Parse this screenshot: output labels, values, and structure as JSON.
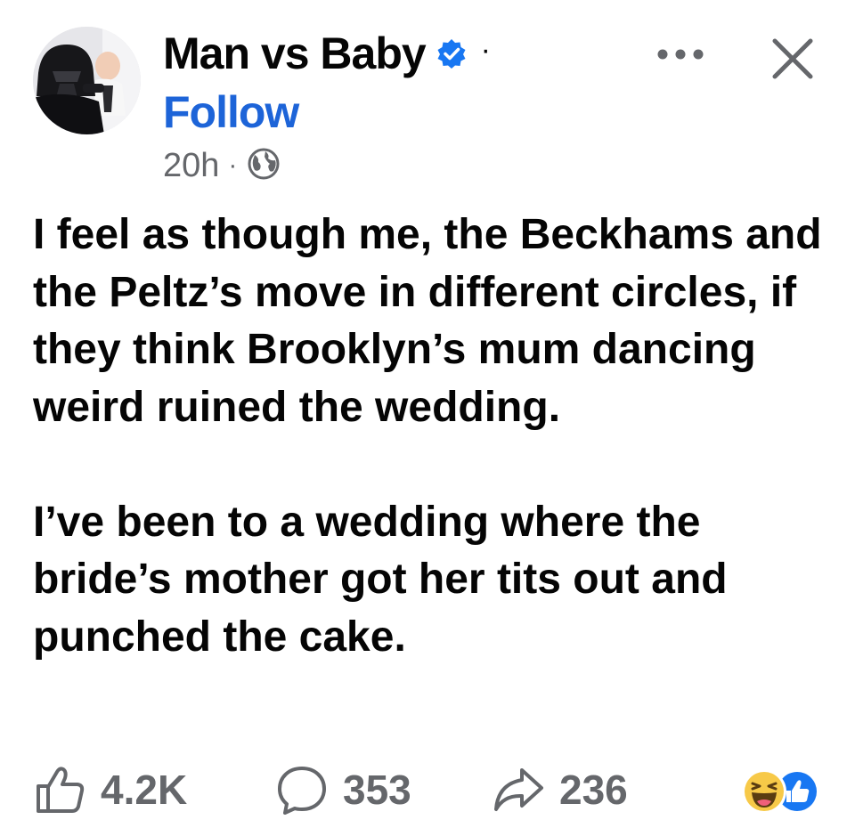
{
  "header": {
    "avatar_icon": "profile-photo-darth-vader-holding-baby",
    "page_name": "Man vs Baby",
    "verified_icon": "verified-badge-icon",
    "follow_label": "Follow",
    "timestamp": "20h",
    "meta_separator": "·",
    "audience_icon": "globe-icon",
    "more_icon": "more-options-icon",
    "close_icon": "close-icon"
  },
  "post": {
    "paragraphs": [
      "I feel as though me, the Beckhams and the Peltz’s move in different circles, if they think Brooklyn’s mum dancing weird ruined the wedding.",
      "I’ve been to a wedding where the bride’s mother got her tits out and punched the cake."
    ]
  },
  "footer": {
    "likes": "4.2K",
    "comments": "353",
    "shares": "236",
    "reaction_icons": [
      "haha-reaction-icon",
      "like-reaction-icon"
    ]
  },
  "colors": {
    "text": "#050505",
    "secondary": "#65676b",
    "accent": "#1d64d8",
    "verified": "#1877f2"
  }
}
